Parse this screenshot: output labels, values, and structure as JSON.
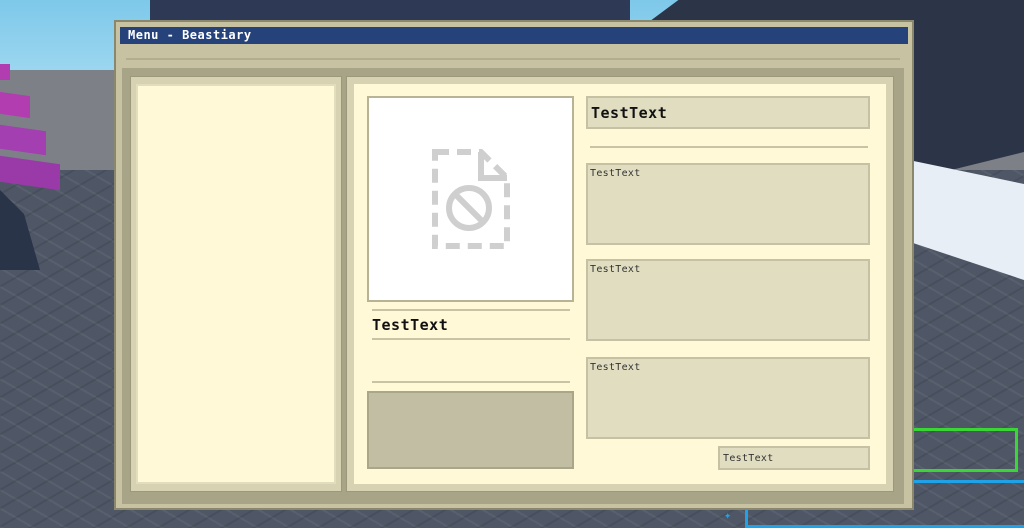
{
  "window": {
    "title": "Menu - Beastiary"
  },
  "entry": {
    "image_icon": "broken-image-icon",
    "name": "TestText",
    "header": "TestText",
    "fields": [
      "TestText",
      "TestText",
      "TestText"
    ],
    "footer": "TestText"
  },
  "colors": {
    "titlebar": "#26427a",
    "panel_bg": "#fff9d8",
    "field_bg": "#e1ddc1",
    "frame": "#c6c2a2",
    "hud_green": "#39d635",
    "hud_blue": "#1fa2e8"
  }
}
